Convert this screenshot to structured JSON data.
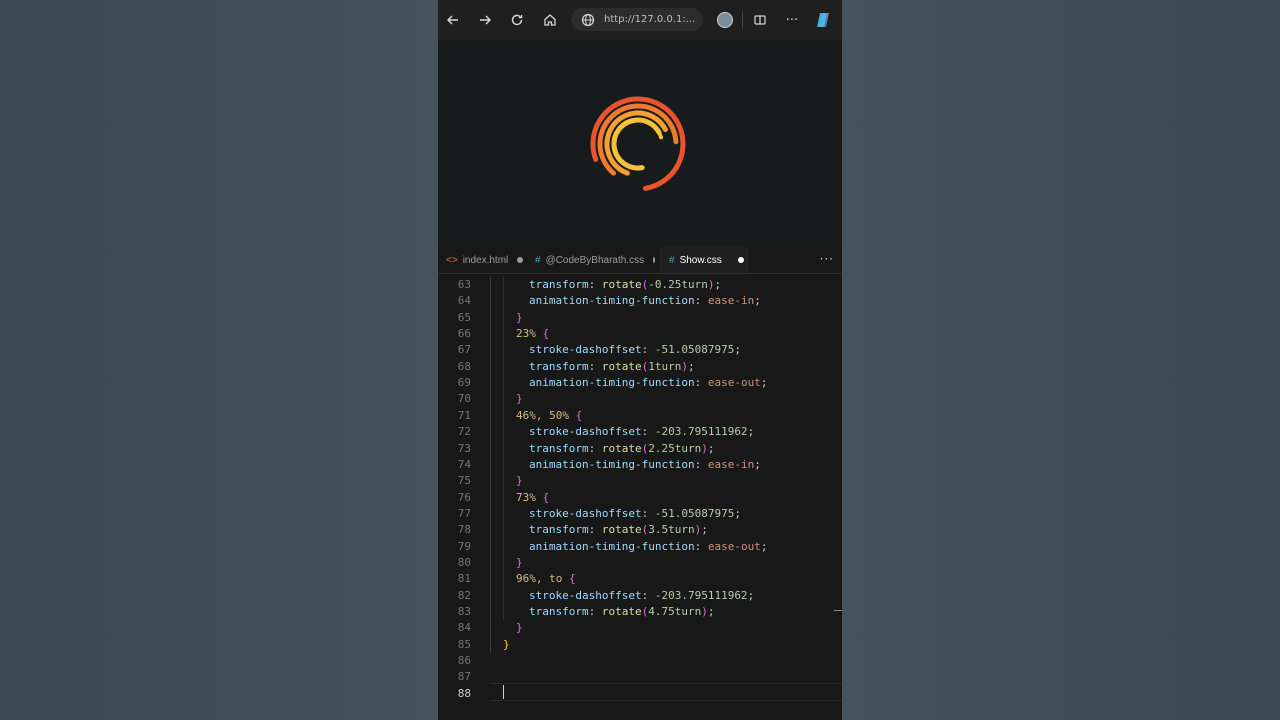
{
  "browser": {
    "url": "http://127.0.0.1:...",
    "icons": [
      "back-icon",
      "forward-icon",
      "refresh-icon",
      "home-icon",
      "globe-icon",
      "profile-avatar",
      "split-screen-icon",
      "more-icon",
      "copilot-icon"
    ]
  },
  "loader": {
    "colors": [
      "#e9542f",
      "#f07a2f",
      "#f5a030",
      "#f6c23c"
    ]
  },
  "tabs": [
    {
      "label": "index.html",
      "icon": "<>",
      "icon_color": "#e37933",
      "active": false
    },
    {
      "label": "@CodeByBharath.css",
      "icon": "#",
      "icon_color": "#519aba",
      "active": false
    },
    {
      "label": "Show.css",
      "icon": "#",
      "icon_color": "#519aba",
      "active": true
    }
  ],
  "more_label": "···",
  "code_lines": [
    {
      "n": "63",
      "indent": 2,
      "tokens": [
        [
          "prop",
          "transform"
        ],
        [
          "pun",
          ": "
        ],
        [
          "fn",
          "rotate"
        ],
        [
          "br1",
          "("
        ],
        [
          "num",
          "-0.25turn"
        ],
        [
          "br1",
          ")"
        ],
        [
          "pun",
          ";"
        ]
      ]
    },
    {
      "n": "64",
      "indent": 2,
      "tokens": [
        [
          "prop",
          "animation-timing-function"
        ],
        [
          "pun",
          ": "
        ],
        [
          "val",
          "ease-in"
        ],
        [
          "pun",
          ";"
        ]
      ]
    },
    {
      "n": "65",
      "indent": 1,
      "tokens": [
        [
          "br1",
          "}"
        ]
      ]
    },
    {
      "n": "66",
      "indent": 1,
      "tokens": [
        [
          "sel",
          "23%"
        ],
        [
          "pun",
          " "
        ],
        [
          "br1",
          "{"
        ]
      ]
    },
    {
      "n": "67",
      "indent": 2,
      "tokens": [
        [
          "prop",
          "stroke-dashoffset"
        ],
        [
          "pun",
          ": "
        ],
        [
          "num",
          "-51.05087975"
        ],
        [
          "pun",
          ";"
        ]
      ]
    },
    {
      "n": "68",
      "indent": 2,
      "tokens": [
        [
          "prop",
          "transform"
        ],
        [
          "pun",
          ": "
        ],
        [
          "fn",
          "rotate"
        ],
        [
          "br1",
          "("
        ],
        [
          "num",
          "1turn"
        ],
        [
          "br1",
          ")"
        ],
        [
          "pun",
          ";"
        ]
      ]
    },
    {
      "n": "69",
      "indent": 2,
      "tokens": [
        [
          "prop",
          "animation-timing-function"
        ],
        [
          "pun",
          ": "
        ],
        [
          "val",
          "ease-out"
        ],
        [
          "pun",
          ";"
        ]
      ]
    },
    {
      "n": "70",
      "indent": 1,
      "tokens": [
        [
          "br1",
          "}"
        ]
      ]
    },
    {
      "n": "71",
      "indent": 1,
      "tokens": [
        [
          "sel",
          "46%, 50%"
        ],
        [
          "pun",
          " "
        ],
        [
          "br1",
          "{"
        ]
      ]
    },
    {
      "n": "72",
      "indent": 2,
      "tokens": [
        [
          "prop",
          "stroke-dashoffset"
        ],
        [
          "pun",
          ": "
        ],
        [
          "num",
          "-203.795111962"
        ],
        [
          "pun",
          ";"
        ]
      ]
    },
    {
      "n": "73",
      "indent": 2,
      "tokens": [
        [
          "prop",
          "transform"
        ],
        [
          "pun",
          ": "
        ],
        [
          "fn",
          "rotate"
        ],
        [
          "br1",
          "("
        ],
        [
          "num",
          "2.25turn"
        ],
        [
          "br1",
          ")"
        ],
        [
          "pun",
          ";"
        ]
      ]
    },
    {
      "n": "74",
      "indent": 2,
      "tokens": [
        [
          "prop",
          "animation-timing-function"
        ],
        [
          "pun",
          ": "
        ],
        [
          "val",
          "ease-in"
        ],
        [
          "pun",
          ";"
        ]
      ]
    },
    {
      "n": "75",
      "indent": 1,
      "tokens": [
        [
          "br1",
          "}"
        ]
      ]
    },
    {
      "n": "76",
      "indent": 1,
      "tokens": [
        [
          "sel",
          "73%"
        ],
        [
          "pun",
          " "
        ],
        [
          "br1",
          "{"
        ]
      ]
    },
    {
      "n": "77",
      "indent": 2,
      "tokens": [
        [
          "prop",
          "stroke-dashoffset"
        ],
        [
          "pun",
          ": "
        ],
        [
          "num",
          "-51.05087975"
        ],
        [
          "pun",
          ";"
        ]
      ]
    },
    {
      "n": "78",
      "indent": 2,
      "tokens": [
        [
          "prop",
          "transform"
        ],
        [
          "pun",
          ": "
        ],
        [
          "fn",
          "rotate"
        ],
        [
          "br1",
          "("
        ],
        [
          "num",
          "3.5turn"
        ],
        [
          "br1",
          ")"
        ],
        [
          "pun",
          ";"
        ]
      ]
    },
    {
      "n": "79",
      "indent": 2,
      "tokens": [
        [
          "prop",
          "animation-timing-function"
        ],
        [
          "pun",
          ": "
        ],
        [
          "val",
          "ease-out"
        ],
        [
          "pun",
          ";"
        ]
      ]
    },
    {
      "n": "80",
      "indent": 1,
      "tokens": [
        [
          "br1",
          "}"
        ]
      ]
    },
    {
      "n": "81",
      "indent": 1,
      "tokens": [
        [
          "sel",
          "96%, to"
        ],
        [
          "pun",
          " "
        ],
        [
          "br1",
          "{"
        ]
      ]
    },
    {
      "n": "82",
      "indent": 2,
      "tokens": [
        [
          "prop",
          "stroke-dashoffset"
        ],
        [
          "pun",
          ": "
        ],
        [
          "num",
          "-203.795111962"
        ],
        [
          "pun",
          ";"
        ]
      ]
    },
    {
      "n": "83",
      "indent": 2,
      "tokens": [
        [
          "prop",
          "transform"
        ],
        [
          "pun",
          ": "
        ],
        [
          "fn",
          "rotate"
        ],
        [
          "br1",
          "("
        ],
        [
          "num",
          "4.75turn"
        ],
        [
          "br1",
          ")"
        ],
        [
          "pun",
          ";"
        ]
      ]
    },
    {
      "n": "84",
      "indent": 1,
      "tokens": [
        [
          "br1",
          "}"
        ]
      ]
    },
    {
      "n": "85",
      "indent": 0,
      "tokens": [
        [
          "br0",
          "}"
        ]
      ]
    },
    {
      "n": "86",
      "indent": 0,
      "tokens": []
    },
    {
      "n": "87",
      "indent": 0,
      "tokens": []
    },
    {
      "n": "88",
      "indent": 0,
      "tokens": [],
      "current": true
    }
  ]
}
